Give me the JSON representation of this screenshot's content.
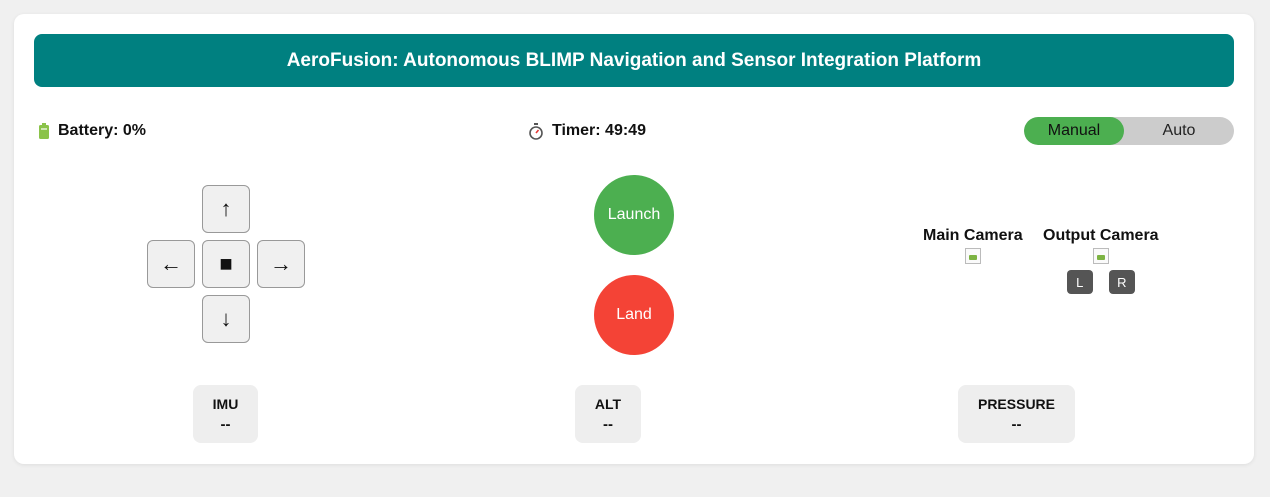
{
  "header": {
    "title": "AeroFusion: Autonomous BLIMP Navigation and Sensor Integration Platform"
  },
  "status": {
    "battery_icon": "battery-icon",
    "battery_text": "Battery: 0%",
    "timer_icon": "stopwatch-icon",
    "timer_text": "Timer: 49:49"
  },
  "mode": {
    "options": [
      "Manual",
      "Auto"
    ],
    "selected": "Manual"
  },
  "dpad": {
    "up": "↑",
    "left": "←",
    "stop": "■",
    "right": "→",
    "down": "↓"
  },
  "flight": {
    "launch_label": "Launch",
    "land_label": "Land"
  },
  "cameras": {
    "main_label": "Main Camera",
    "output_label": "Output Camera",
    "left_label": "L",
    "right_label": "R"
  },
  "sensors": [
    {
      "name": "IMU",
      "value": "--"
    },
    {
      "name": "ALT",
      "value": "--"
    },
    {
      "name": "PRESSURE",
      "value": "--"
    }
  ],
  "colors": {
    "header": "#008080",
    "launch": "#4caf50",
    "land": "#f44336",
    "toggle_active": "#4caf50",
    "toggle_bg": "#cccccc"
  }
}
